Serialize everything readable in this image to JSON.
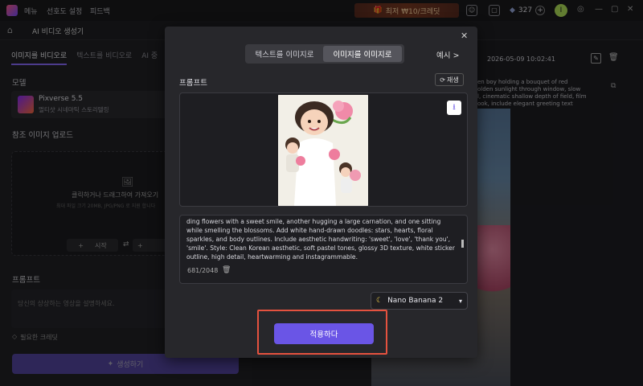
{
  "menu": [
    "메뉴",
    "선호도 설정",
    "피드백"
  ],
  "promo": {
    "text": "최저 ₩10/크레딧"
  },
  "credits": "327",
  "avatar_letter": "I",
  "subbar_title": "AI 비디오 생성기",
  "left": {
    "tabs": [
      "이미지를 비디오로",
      "텍스트를 비디오로",
      "AI 중"
    ],
    "model_label": "모델",
    "model_name": "Pixverse 5.5",
    "model_desc": "멀티샷 시네마틱 스토리텔링",
    "ref_label": "참조 이미지 업로드",
    "upload_text": "클릭하거나 드래그하여 가져오기",
    "upload_hint": "최대 파일 크기 20MB, JPG/PNG 로 지원 합니다",
    "start_label": "시작",
    "prompt_label": "프롬프트",
    "prompt_placeholder": "당신의 상상하는 영상을 설명하세요.",
    "credit_label": "필요한 크레딧",
    "generate_label": "생성하기"
  },
  "right": {
    "timestamp": "2026-05-09 10:02:41",
    "desc_lines": [
      "en boy holding a bouquet of red",
      "olden sunlight through window, slow",
      "l, cinematic shallow depth of field, film",
      "ook, include elegant greeting text"
    ]
  },
  "modal": {
    "seg_text_to_image": "텍스트를 이미지로",
    "seg_image_to_image": "이미지를 이미지로",
    "examples_label": "예시 >",
    "prompt_label": "프롬프트",
    "refresh_label": "재생",
    "prompt_text": "ding flowers with a sweet smile, another hugging a large carnation, and one sitting while smelling the blossoms. Add white hand-drawn doodles: stars, hearts, floral sparkles, and body outlines. Include aesthetic handwriting: 'sweet', 'love', 'thank you', 'smile'. Style: Clean Korean aesthetic, soft pastel tones, glossy 3D texture, white sticker outline, high detail, heartwarming and instagrammable.",
    "char_count": "681/2048",
    "model_select": "Nano Banana 2",
    "apply_label": "적용하다"
  },
  "colors": {
    "accent": "#6a55e6",
    "highlight": "#e5523f"
  }
}
